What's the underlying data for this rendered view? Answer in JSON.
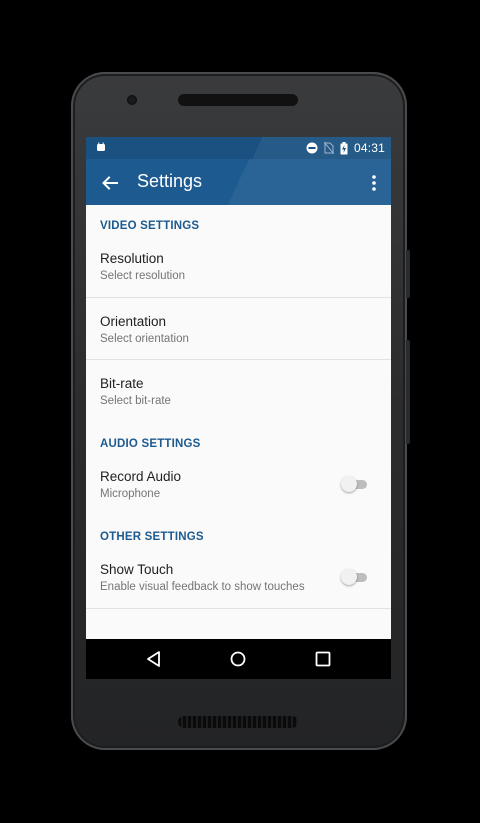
{
  "status_bar": {
    "time": "04:31",
    "left_icon": "android-notification-icon",
    "right_icons": [
      "do-not-disturb-icon",
      "no-sim-icon",
      "battery-charging-icon"
    ]
  },
  "app_bar": {
    "title": "Settings",
    "back_icon": "arrow-back-icon",
    "menu_icon": "more-vert-icon",
    "color": "#1d5a8f"
  },
  "sections": {
    "video": {
      "header": "VIDEO SETTINGS",
      "items": [
        {
          "title": "Resolution",
          "subtitle": "Select resolution"
        },
        {
          "title": "Orientation",
          "subtitle": "Select orientation"
        },
        {
          "title": "Bit-rate",
          "subtitle": "Select bit-rate"
        }
      ]
    },
    "audio": {
      "header": "AUDIO SETTINGS",
      "items": [
        {
          "title": "Record Audio",
          "subtitle": "Microphone",
          "toggle": false
        }
      ]
    },
    "other": {
      "header": "OTHER SETTINGS",
      "items": [
        {
          "title": "Show Touch",
          "subtitle": "Enable visual feedback to show touches",
          "toggle": false
        }
      ]
    }
  },
  "nav_bar": {
    "buttons": [
      "back-triangle-icon",
      "home-circle-icon",
      "recents-square-icon"
    ]
  }
}
